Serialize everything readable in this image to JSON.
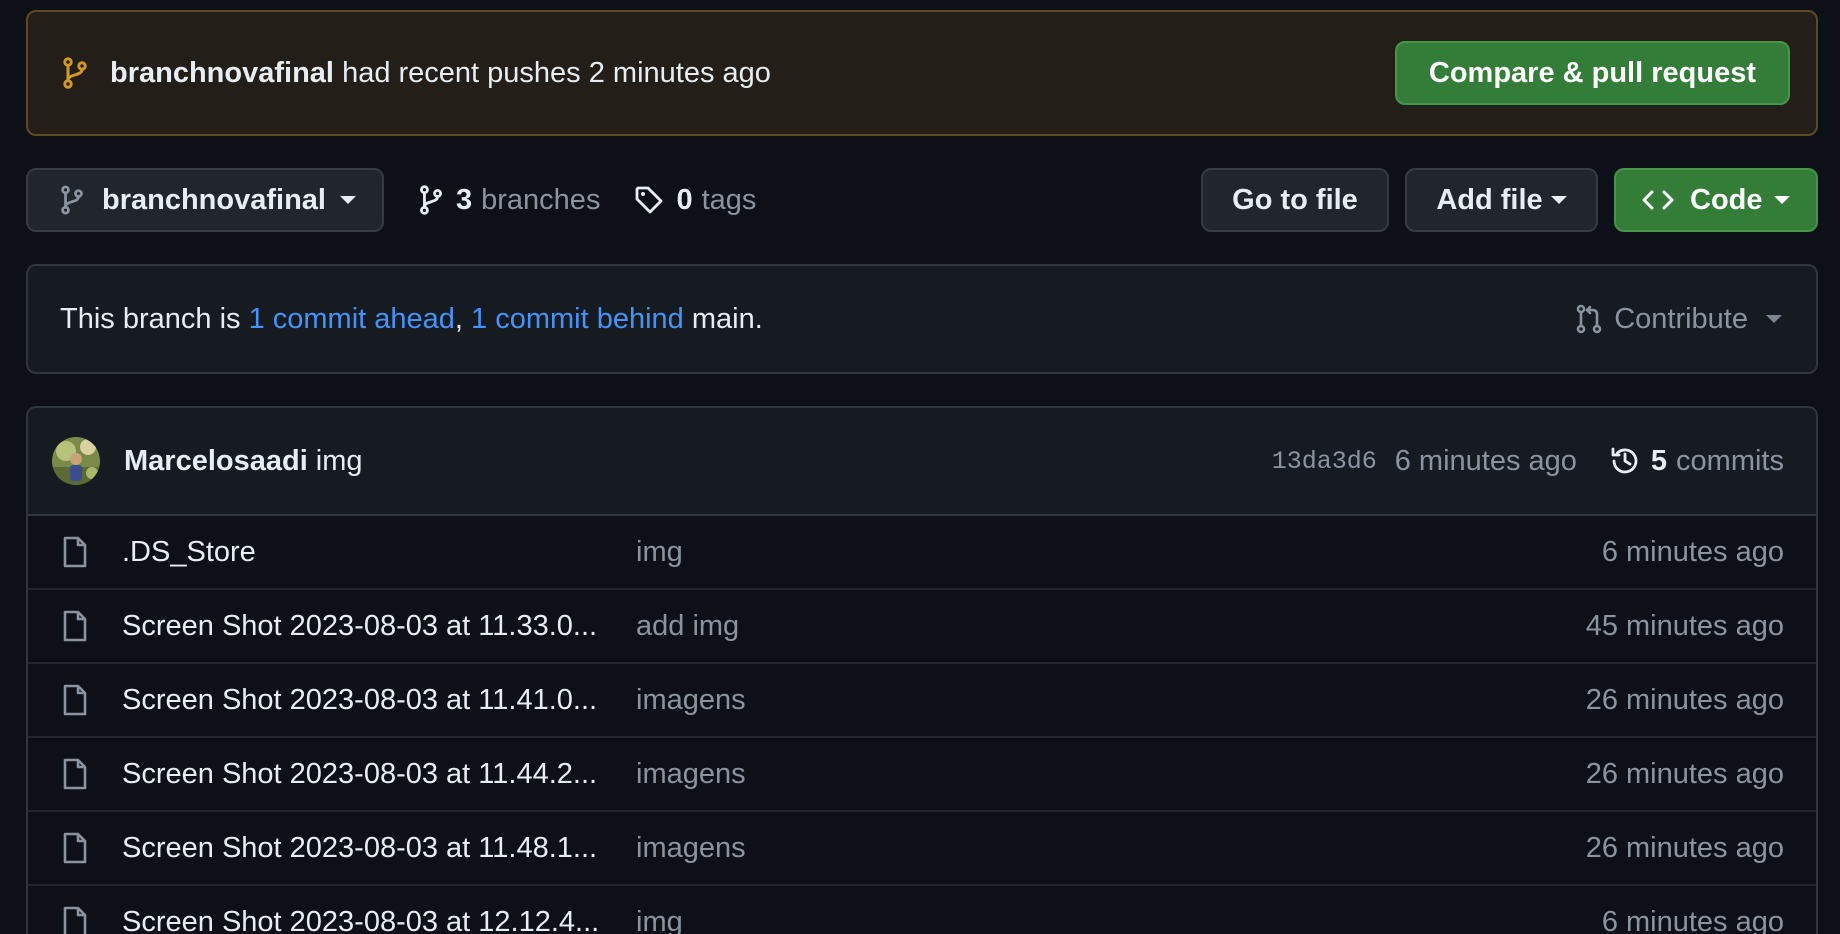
{
  "banner": {
    "branch": "branchnovafinal",
    "text": "had recent pushes 2 minutes ago",
    "button": "Compare & pull request"
  },
  "toolbar": {
    "branch_select": "branchnovafinal",
    "branches_count": "3",
    "branches_label": "branches",
    "tags_count": "0",
    "tags_label": "tags",
    "go_to_file": "Go to file",
    "add_file": "Add file",
    "code": "Code"
  },
  "status": {
    "prefix": "This branch is",
    "ahead": "1 commit ahead",
    "separator": ",",
    "behind": "1 commit behind",
    "suffix": "main.",
    "contribute": "Contribute"
  },
  "latest_commit": {
    "author": "Marcelosaadi",
    "message": "img",
    "sha": "13da3d6",
    "time": "6 minutes ago",
    "commits_count": "5",
    "commits_label": "commits"
  },
  "files": [
    {
      "name": ".DS_Store",
      "message": "img",
      "age": "6 minutes ago"
    },
    {
      "name": "Screen Shot 2023-08-03 at 11.33.0...",
      "message": "add img",
      "age": "45 minutes ago"
    },
    {
      "name": "Screen Shot 2023-08-03 at 11.41.0...",
      "message": "imagens",
      "age": "26 minutes ago"
    },
    {
      "name": "Screen Shot 2023-08-03 at 11.44.2...",
      "message": "imagens",
      "age": "26 minutes ago"
    },
    {
      "name": "Screen Shot 2023-08-03 at 11.48.1...",
      "message": "imagens",
      "age": "26 minutes ago"
    },
    {
      "name": "Screen Shot 2023-08-03 at 12.12.4...",
      "message": "img",
      "age": "6 minutes ago"
    }
  ],
  "colors": {
    "background": "#0d1117",
    "banner_bg": "#231f18",
    "banner_border": "#5b4a22",
    "banner_icon": "#d29922",
    "primary_green": "#347d39",
    "link_blue": "#4493f8",
    "muted_text": "#8b949e"
  },
  "icons": {
    "banner": "git-branch-icon",
    "branch_select": "git-branch-icon",
    "branches": "git-branch-icon",
    "tags": "tag-icon",
    "code": "code-icon",
    "contribute": "git-pull-request-icon",
    "commits": "history-icon",
    "file": "file-icon"
  }
}
